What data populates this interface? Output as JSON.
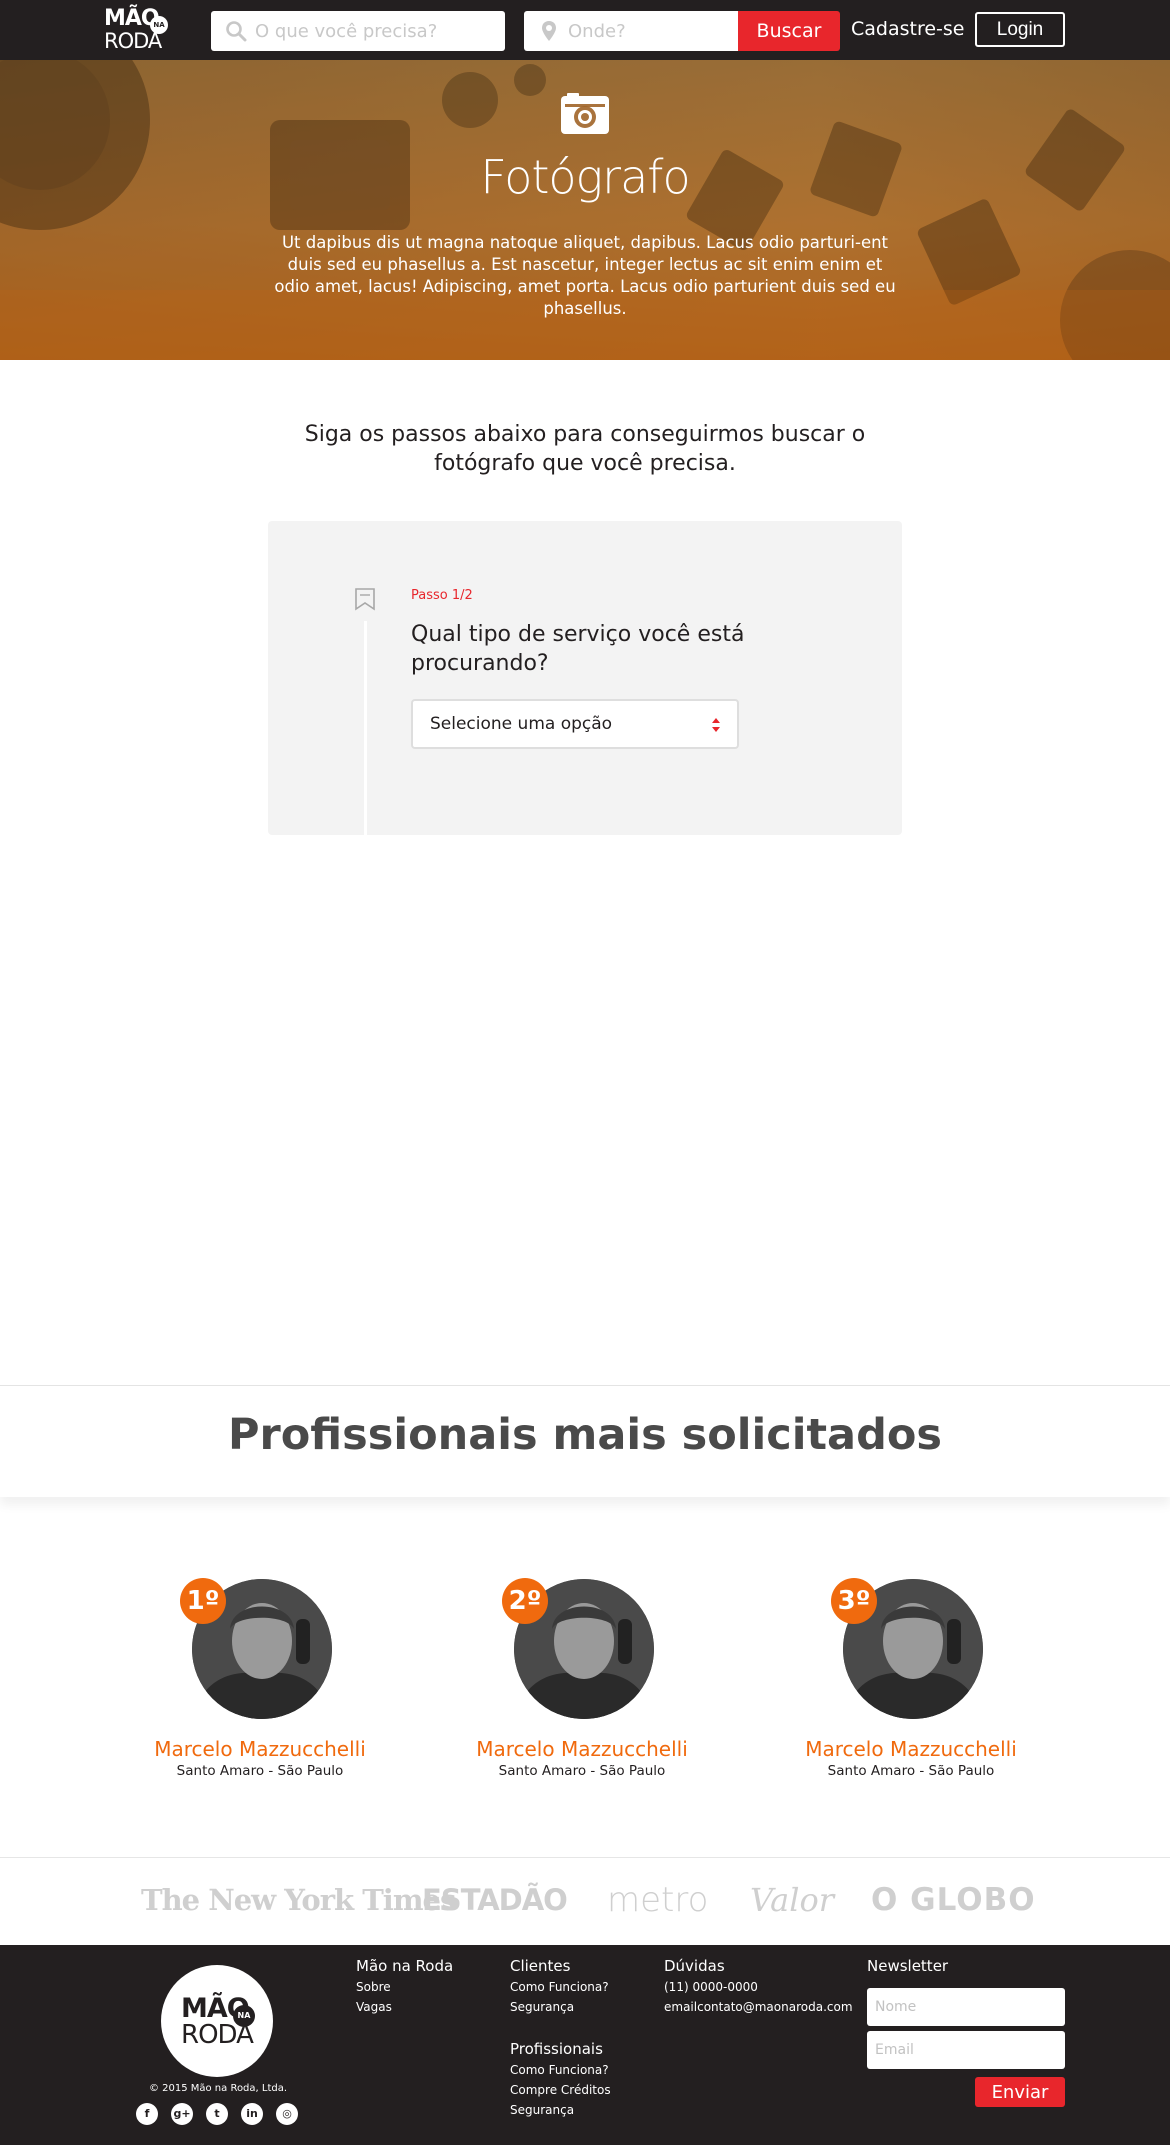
{
  "brand": {
    "line1": "MÃO",
    "badge": "NA",
    "line2": "RODA"
  },
  "nav": {
    "search_placeholder": "O que você precisa?",
    "where_placeholder": "Onde?",
    "search_button": "Buscar",
    "signup": "Cadastre-se",
    "login": "Login"
  },
  "hero": {
    "title": "Fotógrafo",
    "text": "Ut dapibus dis ut magna natoque aliquet, dapibus. Lacus odio parturi-ent duis sed eu phasellus a. Est nascetur, integer lectus ac sit enim enim et odio amet, lacus! Adipiscing, amet porta. Lacus odio parturient duis sed eu phasellus."
  },
  "steps": {
    "intro": "Siga os passos abaixo para conseguirmos buscar o fotógrafo que você precisa.",
    "step_label": "Passo 1/2",
    "question": "Qual tipo de serviço você está procurando?",
    "select_value": "Selecione uma opção"
  },
  "professionals": {
    "title": "Profissionais mais solicitados",
    "items": [
      {
        "rank": "1º",
        "name": "Marcelo Mazzucchelli",
        "location": "Santo Amaro - São Paulo"
      },
      {
        "rank": "2º",
        "name": "Marcelo Mazzucchelli",
        "location": "Santo Amaro - São Paulo"
      },
      {
        "rank": "3º",
        "name": "Marcelo Mazzucchelli",
        "location": "Santo Amaro - São Paulo"
      }
    ]
  },
  "press": [
    "The New York Times",
    "ESTADÃO",
    "metro",
    "Valor",
    "O GLOBO"
  ],
  "footer": {
    "copyright": "© 2015 Mão na Roda, Ltda.",
    "socials": [
      "facebook-icon",
      "google-plus-icon",
      "twitter-icon",
      "linkedin-icon",
      "instagram-icon"
    ],
    "col_mao": {
      "title": "Mão na Roda",
      "links": [
        "Sobre",
        "Vagas"
      ]
    },
    "col_clientes": {
      "title": "Clientes",
      "links": [
        "Como Funciona?",
        "Segurança"
      ]
    },
    "col_profissionais": {
      "title": "Profissionais",
      "links": [
        "Como Funciona?",
        "Compre Créditos",
        "Segurança"
      ]
    },
    "col_duvidas": {
      "title": "Dúvidas",
      "phone": "(11) 0000-0000",
      "email": "emailcontato@maonaroda.com"
    },
    "newsletter": {
      "title": "Newsletter",
      "name_placeholder": "Nome",
      "email_placeholder": "Email",
      "button": "Enviar"
    }
  },
  "colors": {
    "accent": "#e8262c",
    "orange": "#f06a0e",
    "dark": "#231f20"
  }
}
